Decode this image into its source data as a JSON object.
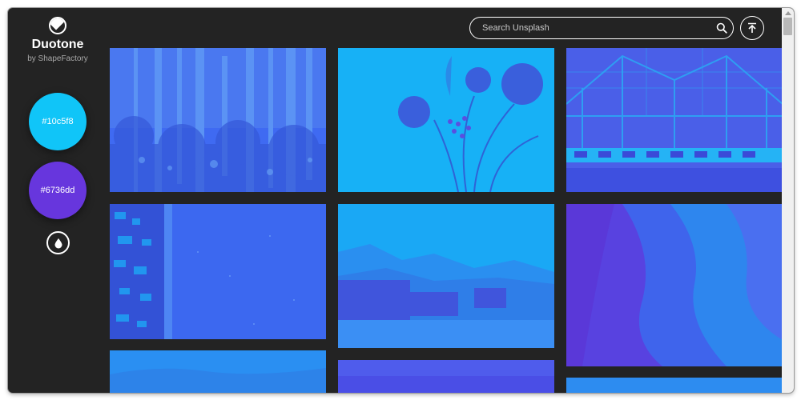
{
  "app": {
    "title": "Duotone",
    "subtitle": "by ShapeFactory"
  },
  "palette": {
    "color_1": "#10c5f8",
    "color_2": "#6736dd"
  },
  "search": {
    "placeholder": "Search Unsplash",
    "value": ""
  },
  "icons": {
    "logo": "half-circle-icon",
    "search": "search-icon",
    "top": "arrow-up-to-top-icon",
    "drop": "drop-icon"
  },
  "photos": [
    {
      "subject": "birch-forest"
    },
    {
      "subject": "flowers"
    },
    {
      "subject": "train-station"
    },
    {
      "subject": "aerial-coast-town"
    },
    {
      "subject": "snowy-valley"
    },
    {
      "subject": "canyon-rock"
    },
    {
      "subject": "landscape-partial"
    },
    {
      "subject": "partial"
    },
    {
      "subject": "partial"
    }
  ]
}
